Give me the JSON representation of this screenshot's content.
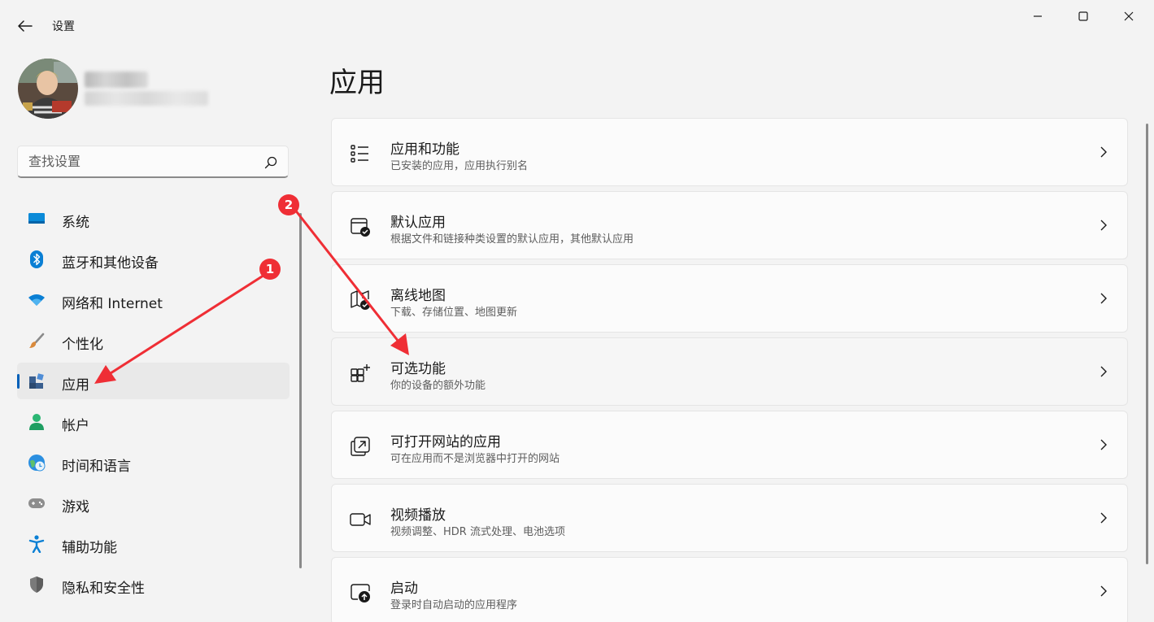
{
  "window": {
    "title": "设置",
    "back_icon": "arrow-left-icon",
    "minimize_icon": "minimize-icon",
    "maximize_icon": "maximize-icon",
    "close_icon": "close-icon"
  },
  "profile": {
    "avatar": "user-avatar-photo",
    "name": "",
    "email": ""
  },
  "search": {
    "placeholder": "查找设置",
    "value": "",
    "icon": "search-icon"
  },
  "sidebar": {
    "active_index": 4,
    "items": [
      {
        "label": "系统",
        "icon": "system-display-icon",
        "color": "#0078d4"
      },
      {
        "label": "蓝牙和其他设备",
        "icon": "bluetooth-icon",
        "color": "#0078d4"
      },
      {
        "label": "网络和 Internet",
        "icon": "wifi-icon",
        "color": "#0078d4"
      },
      {
        "label": "个性化",
        "icon": "brush-icon",
        "color": "#c87941"
      },
      {
        "label": "应用",
        "icon": "apps-icon",
        "color": "#3b6ea8"
      },
      {
        "label": "帐户",
        "icon": "account-icon",
        "color": "#2bb673"
      },
      {
        "label": "时间和语言",
        "icon": "globe-clock-icon",
        "color": "#0078d4"
      },
      {
        "label": "游戏",
        "icon": "gamepad-icon",
        "color": "#8a8a8a"
      },
      {
        "label": "辅助功能",
        "icon": "accessibility-icon",
        "color": "#0078d4"
      },
      {
        "label": "隐私和安全性",
        "icon": "shield-icon",
        "color": "#6b6b6b"
      }
    ]
  },
  "main": {
    "title": "应用",
    "cards": [
      {
        "title": "应用和功能",
        "subtitle": "已安装的应用，应用执行别名",
        "icon": "apps-list-icon",
        "chevron": "chevron-right-icon"
      },
      {
        "title": "默认应用",
        "subtitle": "根据文件和链接种类设置的默认应用，其他默认应用",
        "icon": "default-apps-icon",
        "chevron": "chevron-right-icon"
      },
      {
        "title": "离线地图",
        "subtitle": "下载、存储位置、地图更新",
        "icon": "offline-map-icon",
        "chevron": "chevron-right-icon"
      },
      {
        "title": "可选功能",
        "subtitle": "你的设备的额外功能",
        "icon": "optional-features-icon",
        "chevron": "chevron-right-icon"
      },
      {
        "title": "可打开网站的应用",
        "subtitle": "可在应用而不是浏览器中打开的网站",
        "icon": "open-website-icon",
        "chevron": "chevron-right-icon"
      },
      {
        "title": "视频播放",
        "subtitle": "视频调整、HDR 流式处理、电池选项",
        "icon": "video-camera-icon",
        "chevron": "chevron-right-icon"
      },
      {
        "title": "启动",
        "subtitle": "登录时自动启动的应用程序",
        "icon": "startup-icon",
        "chevron": "chevron-right-icon"
      }
    ]
  },
  "annotations": {
    "color": "#ef2e35",
    "badges": [
      {
        "label": "1",
        "points_to": "sidebar-item-apps"
      },
      {
        "label": "2",
        "points_to": "card-optional-features"
      }
    ]
  }
}
